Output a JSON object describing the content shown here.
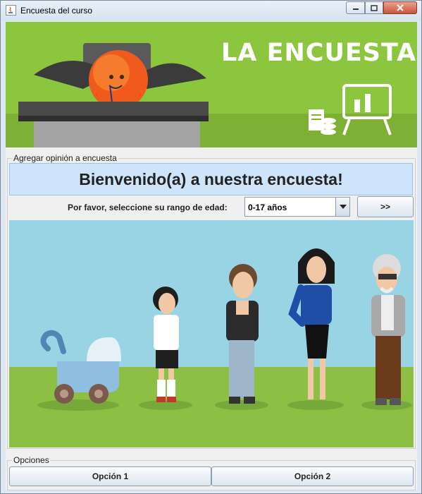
{
  "window": {
    "title": "Encuesta del curso"
  },
  "banner": {
    "title": "LA ENCUESTA"
  },
  "survey_group": {
    "legend": "Agregar opinión a encuesta",
    "welcome": "Bienvenido(a) a nuestra encuesta!",
    "age_label": "Por favor, seleccione su rango de edad:",
    "age_select": {
      "selected": "0-17 años"
    },
    "next_label": ">>"
  },
  "options_group": {
    "legend": "Opciones",
    "option1": "Opción 1",
    "option2": "Opción 2"
  },
  "colors": {
    "banner_green": "#8cc63f",
    "sky": "#98d4e4",
    "grass": "#8dbf45",
    "welcome_bg": "#cde4fb",
    "accent_orange": "#f15a1d"
  }
}
